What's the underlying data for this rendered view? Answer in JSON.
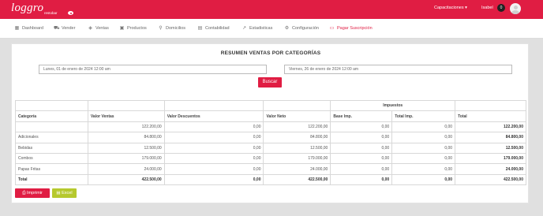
{
  "brand": {
    "logo": "loggro",
    "logo_sub": "restobar"
  },
  "topbar": {
    "capacitaciones": "Capacitaciones",
    "user": "Isabel",
    "badge": "0"
  },
  "nav": [
    {
      "label": "Dashboard",
      "icon": "grid-icon"
    },
    {
      "label": "Vender",
      "icon": "cart-icon"
    },
    {
      "label": "Ventas",
      "icon": "tag-icon"
    },
    {
      "label": "Productos",
      "icon": "box-icon"
    },
    {
      "label": "Domicilios",
      "icon": "bike-icon"
    },
    {
      "label": "Contabilidad",
      "icon": "calendar-icon"
    },
    {
      "label": "Estadisticas",
      "icon": "trend-icon"
    },
    {
      "label": "Configuración",
      "icon": "gear-icon"
    },
    {
      "label": "Pagar Suscripción",
      "icon": "card-icon"
    }
  ],
  "report": {
    "title": "RESUMEN VENTAS POR CATEGORÍAS",
    "date_from": "Lunes, 01 de enero de 2024 12:00 am",
    "date_to": "Viernes, 26 de enero de 2024 12:00 am",
    "search_button": "Buscar",
    "group_header": "Impuestos",
    "columns": [
      "Categoría",
      "Valor Ventas",
      "Valor Descuentos",
      "Valor Neto",
      "Base Imp.",
      "Total Imp.",
      "Total"
    ],
    "rows": [
      [
        "",
        "122.200,00",
        "0,00",
        "122.200,00",
        "0,00",
        "0,00",
        "122.200,00"
      ],
      [
        "Adicionales",
        "84.800,00",
        "0,00",
        "84.800,00",
        "0,00",
        "0,00",
        "84.800,00"
      ],
      [
        "Bebidas",
        "12.500,00",
        "0,00",
        "12.500,00",
        "0,00",
        "0,00",
        "12.500,00"
      ],
      [
        "Combos",
        "179.000,00",
        "0,00",
        "179.000,00",
        "0,00",
        "0,00",
        "179.000,00"
      ],
      [
        "Papas Fritas",
        "24.000,00",
        "0,00",
        "24.000,00",
        "0,00",
        "0,00",
        "24.000,00"
      ]
    ],
    "total_row": [
      "Total",
      "422.500,00",
      "0,00",
      "422.500,00",
      "0,00",
      "0,00",
      "422.500,00"
    ],
    "print_button": "Imprimir",
    "excel_button": "Excel"
  }
}
